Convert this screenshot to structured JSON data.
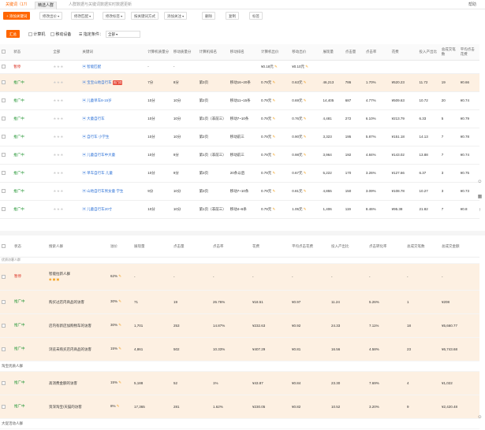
{
  "tabs": [
    {
      "label": "关键词（17）",
      "state": "active"
    },
    {
      "label": "精选人群",
      "state": "selected"
    },
    {
      "label": "人群数据与关键词数据实时数据更新",
      "state": "info"
    }
  ],
  "top_right": "帮助",
  "toolbar": {
    "add_keyword": "+ 添加关键词",
    "modify_bid": "修改出价",
    "modify_match": "修改匹配",
    "modify_tag": "修改标签",
    "sort_by_keyword": "按关键词方式",
    "add_follow": "添加关注",
    "delete": "删除",
    "copy": "复制",
    "tag": "标签"
  },
  "filterbar": {
    "mode_btn": "汇总",
    "platform_label": "计算机",
    "mobile_label": "移动设备",
    "range_label": "☰ 指定条件：",
    "range_value": "全部"
  },
  "table1": {
    "headers": [
      "状态",
      "全部",
      "关键词",
      "计算机质量分",
      "移动质量分",
      "计算机排名",
      "移动排名",
      "计算机出价",
      "移动出价",
      "展现量",
      "点击量",
      "点击率",
      "花费",
      "投入产出比",
      "总成交笔数",
      "平均点击花费"
    ],
    "rows": [
      {
        "status": "暂停",
        "status_type": "off",
        "keyword": "智能匹配",
        "q1": "-",
        "q2": "-",
        "r1": "",
        "r2": "",
        "p1": "¥0.18元",
        "p2": "¥0.10元",
        "impr": "",
        "clicks": "",
        "ctr": "",
        "cost": "",
        "roi": "",
        "orders": "",
        "avg": "",
        "hl": false
      },
      {
        "status": "推广中",
        "status_type": "on",
        "keyword": "宝宝山地自行车",
        "badge": "热门词",
        "q1": "7分",
        "q2": "8分",
        "r1": "第3页",
        "r2": "移动16~20条",
        "p1": "0.79元",
        "p2": "0.63元",
        "impr": "46,213",
        "clicks": "786",
        "ctr": "1.70%",
        "cost": "¥520.23",
        "roi": "11.72",
        "orders": "19",
        "avg": "¥0.66",
        "hl": true
      },
      {
        "status": "推广中",
        "status_type": "on",
        "keyword": "儿童单车8-15岁",
        "q1": "10分",
        "q2": "10分",
        "r1": "第2页",
        "r2": "移动11~15条",
        "p1": "0.79元",
        "p2": "0.69元",
        "impr": "14,405",
        "clicks": "687",
        "ctr": "4.77%",
        "cost": "¥509.63",
        "roi": "10.72",
        "orders": "20",
        "avg": "¥0.74",
        "hl": false
      },
      {
        "status": "推广中",
        "status_type": "on",
        "keyword": "大童自行车",
        "q1": "10分",
        "q2": "10分",
        "r1": "第1页（非前三）",
        "r2": "移动7~10条",
        "p1": "0.79元",
        "p2": "0.76元",
        "impr": "4,481",
        "clicks": "272",
        "ctr": "6.10%",
        "cost": "¥213.79",
        "roi": "6.33",
        "orders": "5",
        "avg": "¥0.79",
        "hl": false
      },
      {
        "status": "推广中",
        "status_type": "on",
        "keyword": "自行车 小学生",
        "q1": "10分",
        "q2": "10分",
        "r1": "第2页",
        "r2": "移动前三",
        "p1": "0.79元",
        "p2": "0.90元",
        "impr": "3,323",
        "clicks": "195",
        "ctr": "5.87%",
        "cost": "¥151.18",
        "roi": "14.13",
        "orders": "7",
        "avg": "¥0.78",
        "hl": false
      },
      {
        "status": "推广中",
        "status_type": "on",
        "keyword": "儿童自行车中大童",
        "q1": "10分",
        "q2": "9分",
        "r1": "第1页（非前三）",
        "r2": "移动前三",
        "p1": "0.79元",
        "p2": "0.98元",
        "impr": "3,964",
        "clicks": "192",
        "ctr": "4.84%",
        "cost": "¥143.02",
        "roi": "13.88",
        "orders": "7",
        "avg": "¥0.74",
        "hl": false
      },
      {
        "status": "推广中",
        "status_type": "on",
        "keyword": "单车自行车 儿童",
        "q1": "10分",
        "q2": "9分",
        "r1": "第3页",
        "r2": "20条以后",
        "p1": "0.79元",
        "p2": "0.67元",
        "impr": "5,222",
        "clicks": "170",
        "ctr": "3.26%",
        "cost": "¥127.66",
        "roi": "6.37",
        "orders": "3",
        "avg": "¥0.75",
        "hl": false
      },
      {
        "status": "推广中",
        "status_type": "on",
        "keyword": "山地自行车男女童 学生",
        "q1": "9分",
        "q2": "10分",
        "r1": "第3页",
        "r2": "移动7~10条",
        "p1": "0.79元",
        "p2": "0.81元",
        "impr": "4,855",
        "clicks": "150",
        "ctr": "3.09%",
        "cost": "¥108.78",
        "roi": "10.27",
        "orders": "3",
        "avg": "¥0.73",
        "hl": false
      },
      {
        "status": "推广中",
        "status_type": "on",
        "keyword": "儿童自行车20寸",
        "q1": "10分",
        "q2": "10分",
        "r1": "第1页（非前三）",
        "r2": "移动4~6条",
        "p1": "0.79元",
        "p2": "1.05元",
        "impr": "1,406",
        "clicks": "119",
        "ctr": "8.46%",
        "cost": "¥95.38",
        "roi": "21.82",
        "orders": "7",
        "avg": "¥0.8",
        "hl": false
      }
    ]
  },
  "table2": {
    "headers": [
      "状态",
      "搜索人群",
      "溢价",
      "展现量",
      "点击量",
      "点击率",
      "花费",
      "平均点击花费",
      "投入产出比",
      "点击转化率",
      "总成交笔数",
      "总成交金额"
    ],
    "group_top": "优质访客人群",
    "rows": [
      {
        "type": "row",
        "status": "暂停",
        "status_type": "off",
        "name": "智能拉新人群",
        "premium": "62%",
        "impr": "-",
        "clicks": "-",
        "ctr": "-",
        "cost": "-",
        "avg": "-",
        "roi": "-",
        "cvr": "-",
        "orders": "-",
        "amount": "-",
        "hl": true
      },
      {
        "type": "row",
        "status": "推广中",
        "status_type": "on",
        "name": "购买过店内商品的访客",
        "premium": "30%",
        "impr": "71",
        "clicks": "19",
        "ctr": "26.76%",
        "cost": "¥18.51",
        "avg": "¥0.97",
        "roi": "11.24",
        "cvr": "5.26%",
        "orders": "1",
        "amount": "¥208",
        "hl": true
      },
      {
        "type": "row",
        "status": "推广中",
        "status_type": "on",
        "name": "店内有新店加购物车的访客",
        "premium": "30%",
        "impr": "1,701",
        "clicks": "253",
        "ctr": "14.87%",
        "cost": "¥232.63",
        "avg": "¥0.92",
        "roi": "24.33",
        "cvr": "7.11%",
        "orders": "18",
        "amount": "¥5,660.77",
        "hl": true
      },
      {
        "type": "row",
        "status": "推广中",
        "status_type": "on",
        "name": "浏览未购买店内商品的访客",
        "premium": "15%",
        "impr": "4,861",
        "clicks": "502",
        "ctr": "10.33%",
        "cost": "¥407.29",
        "avg": "¥0.81",
        "roi": "16.56",
        "cvr": "4.58%",
        "orders": "23",
        "amount": "¥6,743.68",
        "hl": true
      },
      {
        "type": "group",
        "label": "淘宝优质人群"
      },
      {
        "type": "row",
        "status": "推广中",
        "status_type": "on",
        "name": "高消费金额的访客",
        "premium": "15%",
        "impr": "5,188",
        "clicks": "52",
        "ctr": "1%",
        "cost": "¥43.87",
        "avg": "¥0.84",
        "roi": "23.30",
        "cvr": "7.69%",
        "orders": "4",
        "amount": "¥1,022",
        "hl": true
      },
      {
        "type": "row",
        "status": "推广中",
        "status_type": "on",
        "name": "资深淘宝/天猫的访客",
        "premium": "8%",
        "impr": "17,365",
        "clicks": "281",
        "ctr": "1.62%",
        "cost": "¥230.05",
        "avg": "¥0.82",
        "roi": "10.52",
        "cvr": "3.20%",
        "orders": "9",
        "amount": "¥2,420.48",
        "hl": true
      },
      {
        "type": "group",
        "label": "大促活动人群"
      }
    ]
  },
  "icons": {
    "top_right": "help-icon",
    "side": [
      "user-service-icon",
      "qr-code-icon",
      "back-top-icon",
      "chat-icon"
    ]
  },
  "colors": {
    "accent": "#ff6600",
    "status_on": "#2c9a3c",
    "status_off": "#d9281a",
    "highlight_row": "#fdf0e2",
    "link": "#2a6fd6"
  }
}
